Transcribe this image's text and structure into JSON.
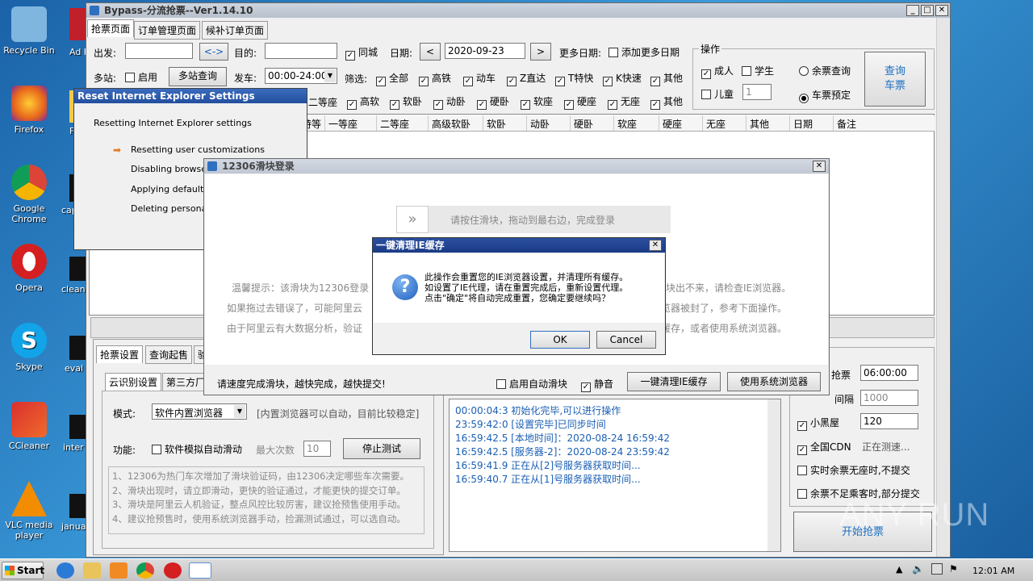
{
  "desktop": {
    "icons": [
      {
        "label": "Recycle Bin",
        "color": "#7fb6e0"
      },
      {
        "label": "Firefox",
        "color": "#e8661c"
      },
      {
        "label": "Google Chrome",
        "color": "#3a9a44"
      },
      {
        "label": "Opera",
        "color": "#d42020"
      },
      {
        "label": "Skype",
        "color": "#12a4e8"
      },
      {
        "label": "CCleaner",
        "color": "#d93030"
      },
      {
        "label": "VLC media player",
        "color": "#f28c00"
      }
    ],
    "partial_icons": [
      "Ad Rea",
      "File",
      "cap",
      "clean",
      "eval",
      "inter",
      "janua"
    ]
  },
  "main_window": {
    "title": "Bypass-分流抢票--Ver1.14.10",
    "tabs": [
      "抢票页面",
      "订单管理页面",
      "候补订单页面"
    ],
    "from_label": "出发:",
    "swap_label": "<->",
    "to_label": "目的:",
    "same_city_label": "同城",
    "date_label": "日期:",
    "date_value": "2020-09-23",
    "prev_label": "<",
    "next_label": ">",
    "more_dates_label": "更多日期:",
    "add_more_dates_label": "添加更多日期",
    "multi_station_label": "多站:",
    "enable_label": "启用",
    "multi_station_query": "多站查询",
    "depart_label": "发车:",
    "depart_time": "00:00-24:00",
    "filter_label": "筛选:",
    "filters": [
      "全部",
      "高铁",
      "动车",
      "Z直达",
      "T特快",
      "K快速",
      "其他"
    ],
    "seat_filters": [
      "二等座",
      "高软",
      "软卧",
      "动卧",
      "硬卧",
      "软座",
      "硬座",
      "无座",
      "其他"
    ],
    "ops_group": "操作",
    "adult_label": "成人",
    "student_label": "学生",
    "child_label": "儿童",
    "child_count": "1",
    "remain_query_label": "余票查询",
    "book_label": "车票预定",
    "query_button": "查询\n车票",
    "grid_headers": [
      "特等",
      "一等座",
      "二等座",
      "高级软卧",
      "软卧",
      "动卧",
      "硬卧",
      "软座",
      "硬座",
      "无座",
      "其他",
      "日期",
      "备注"
    ],
    "lower_tabs": [
      "抢票设置",
      "查询起售",
      "验"
    ],
    "sub_tabs": [
      "云识别设置",
      "第三方厂"
    ],
    "mode_label": "模式:",
    "mode_value": "软件内置浏览器",
    "mode_note": "[内置浏览器可以自动，目前比较稳定]",
    "function_label": "功能:",
    "auto_slide_label": "软件模拟自动滑动",
    "max_times_label": "最大次数",
    "max_times_value": "10",
    "stop_test_button": "停止测试",
    "notes": [
      "1、12306为热门车次增加了滑块验证码，由12306决定哪些车次需要。",
      "2、滑块出现时，请立即滑动，更快的验证通过，才能更快的提交订单。",
      "3、滑块是阿里云人机验证，整点风控比较厉害，建议抢预售使用手动。",
      "4、建议抢预售时，使用系统浏览器手动，捡漏测试通过，可以选自动。"
    ],
    "log_lines": [
      "00:00:04:3  初始化完毕,可以进行操作",
      "23:59:42:0  [设置完毕]已同步时间",
      "16:59:42.5  [本地时间]：2020-08-24 16:59:42",
      "16:59:42.5  [服务器-2]：2020-08-24 23:59:42",
      "16:59:41.9  正在从[2]号服务器获取时间...",
      "16:59:40.7  正在从[1]号服务器获取时间..."
    ],
    "right_panel": {
      "grab_time_label": "抢票",
      "grab_time_value": "06:00:00",
      "interval_label": "间隔",
      "interval_value": "1000",
      "small_black_label": "小黑屋",
      "small_black_value": "120",
      "cdn_label": "全国CDN",
      "cdn_status": "正在测速...",
      "realtime_label": "实时余票无座时,不提交",
      "partial_label": "余票不足乘客时,部分提交",
      "start_button": "开始抢票"
    }
  },
  "ie_reset": {
    "title": "Reset Internet Explorer Settings",
    "heading": "Resetting Internet Explorer settings",
    "steps": [
      "Resetting user customizations",
      "Disabling browser a",
      "Applying default se",
      "Deleting personal s"
    ]
  },
  "slider_login": {
    "title": "12306滑块登录",
    "slider_hint": "请按住滑块，拖动到最右边，完成登录",
    "slider_arrow": "»",
    "tips": [
      "温馨提示：该滑块为12306登录",
      "如果拖过去错误了，可能阿里云",
      "由于阿里云有大数据分析，验证"
    ],
    "tips_right": [
      "块出不来，请检查IE浏览器。",
      "览器被封了，参考下面操作。",
      "缓存，或者使用系统浏览器。"
    ],
    "bottom_hint": "请速度完成滑块，越快完成，越快提交!",
    "auto_slide_label": "启用自动滑块",
    "mute_label": "静音",
    "clear_ie_button": "一键清理IE缓存",
    "system_browser_button": "使用系统浏览器"
  },
  "confirm_dialog": {
    "title": "一键清理IE缓存",
    "message": [
      "此操作会重置您的IE浏览器设置，并清理所有缓存。",
      "如设置了IE代理，请在重置完成后，重新设置代理。",
      "点击\"确定\"将自动完成重置，您确定要继续吗？"
    ],
    "ok_label": "OK",
    "cancel_label": "Cancel"
  },
  "taskbar": {
    "start_label": "Start",
    "time": "12:01 AM"
  },
  "watermark": "ANY RUN"
}
